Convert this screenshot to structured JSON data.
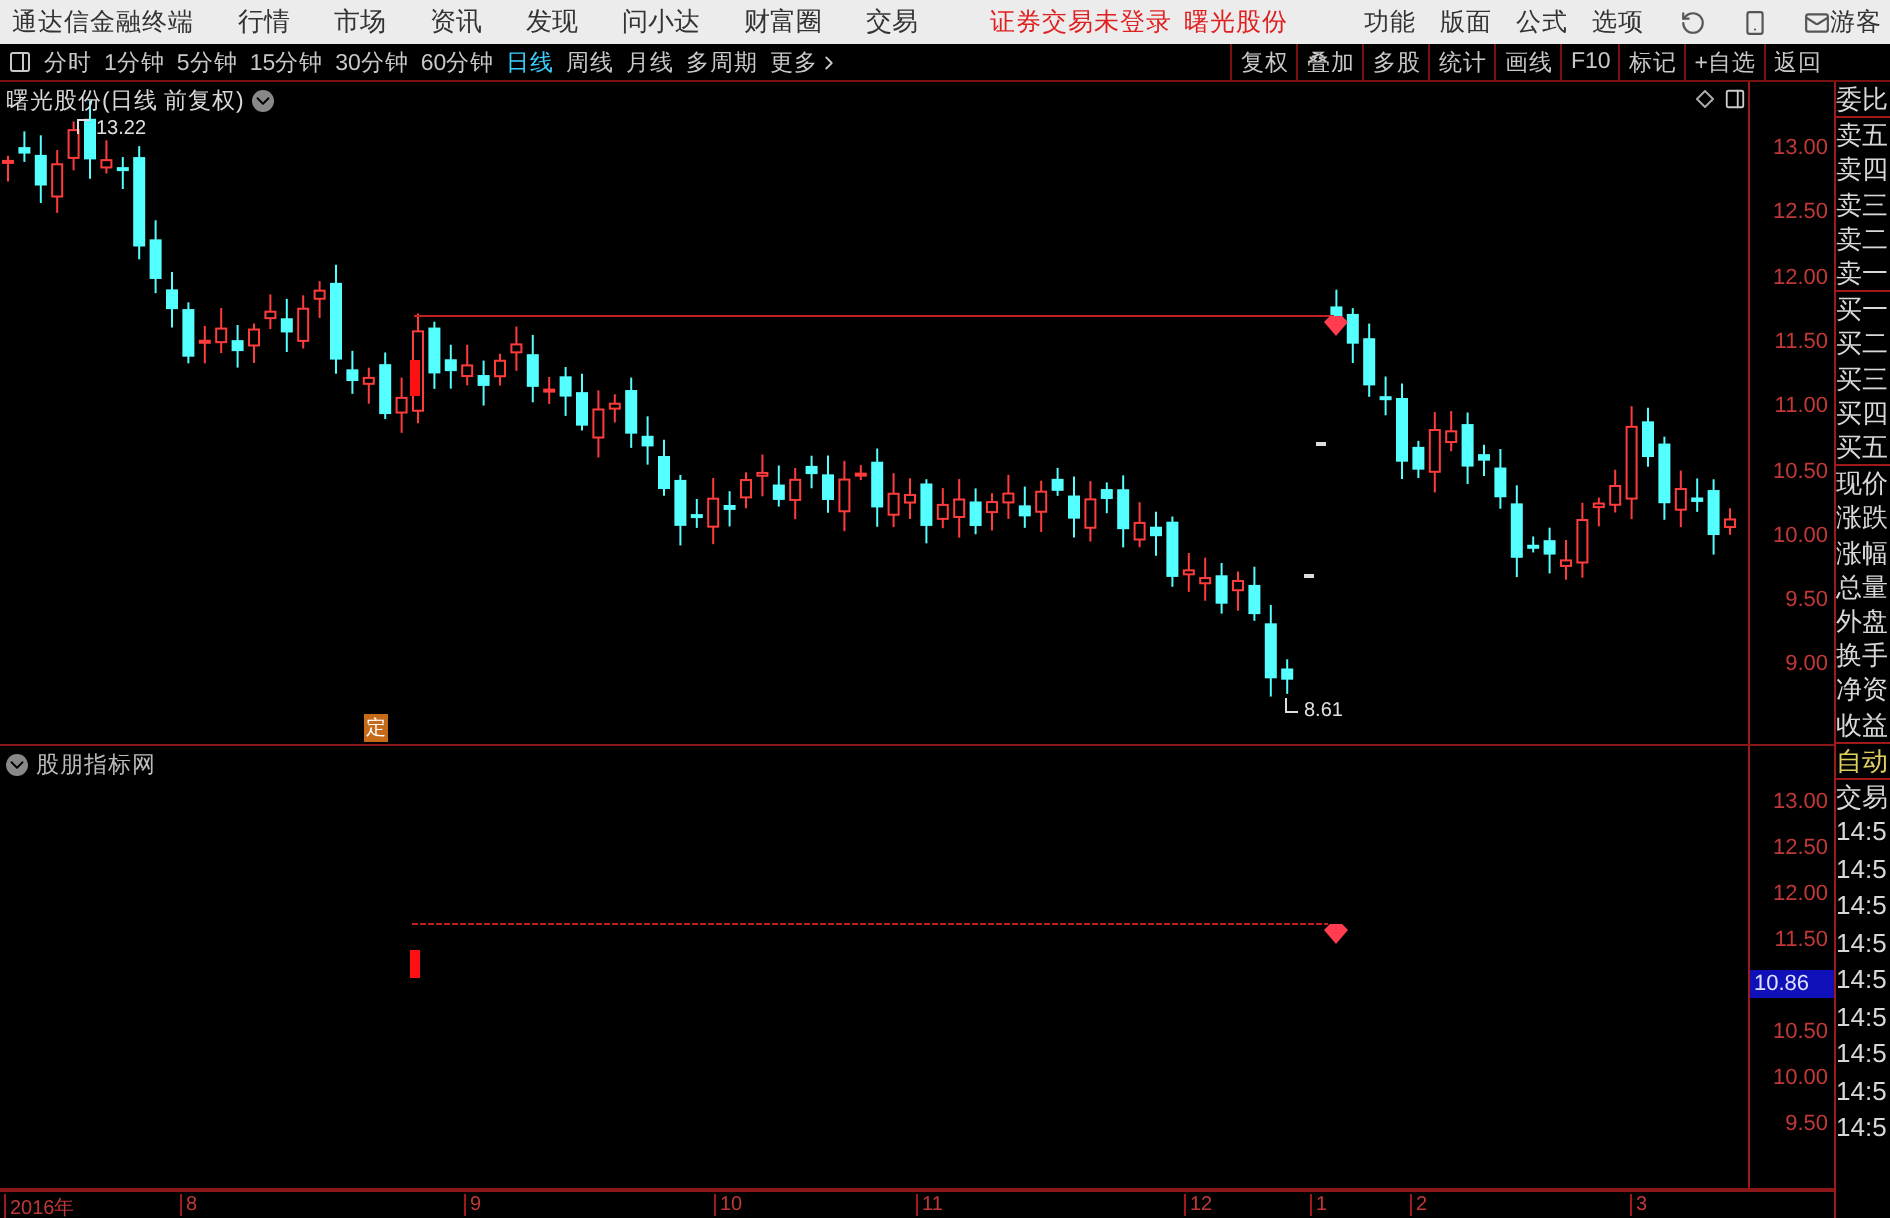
{
  "app": {
    "title": "通达信金融终端",
    "menu": [
      "行情",
      "市场",
      "资讯",
      "发现",
      "问小达",
      "财富圈",
      "交易"
    ],
    "notices": [
      "证券交易未登录",
      "曙光股份"
    ],
    "tools": [
      "功能",
      "版面",
      "公式",
      "选项"
    ],
    "user": "游客"
  },
  "periods": [
    {
      "label": "分时",
      "selected": false
    },
    {
      "label": "1分钟",
      "selected": false
    },
    {
      "label": "5分钟",
      "selected": false
    },
    {
      "label": "15分钟",
      "selected": false
    },
    {
      "label": "30分钟",
      "selected": false
    },
    {
      "label": "60分钟",
      "selected": false
    },
    {
      "label": "日线",
      "selected": true
    },
    {
      "label": "周线",
      "selected": false
    },
    {
      "label": "月线",
      "selected": false
    },
    {
      "label": "多周期",
      "selected": false
    }
  ],
  "more": "更多",
  "actions": [
    "复权",
    "叠加",
    "多股",
    "统计",
    "画线",
    "F10",
    "标记",
    "+自选",
    "返回"
  ],
  "main_chart": {
    "title": "曙光股份(日线 前复权)",
    "axis": [
      "13.00",
      "12.50",
      "12.00",
      "11.50",
      "11.00",
      "10.50",
      "10.00",
      "9.50",
      "9.00"
    ],
    "high": "13.22",
    "low": "8.61",
    "badge": "定"
  },
  "indicator": {
    "title": "股朋指标网",
    "axis": [
      "13.00",
      "12.50",
      "12.00",
      "11.50",
      "10.50",
      "10.00",
      "9.50"
    ],
    "current": "10.86"
  },
  "quote_panel": {
    "groups": [
      [
        "委比"
      ],
      [
        "卖五",
        "卖四",
        "卖三",
        "卖二",
        "卖一"
      ],
      [
        "买一",
        "买二",
        "买三",
        "买四",
        "买五"
      ],
      [
        "现价",
        "涨跌",
        "涨幅",
        "总量",
        "外盘",
        "换手",
        "净资",
        "收益"
      ]
    ],
    "auto": "自动",
    "trade": "交易",
    "times": [
      "14:5",
      "14:5",
      "14:5",
      "14:5",
      "14:5",
      "14:5",
      "14:5",
      "14:5",
      "14:5"
    ]
  },
  "time_axis": [
    "2016年",
    "8",
    "9",
    "10",
    "11",
    "12",
    "1",
    "2",
    "3"
  ]
}
